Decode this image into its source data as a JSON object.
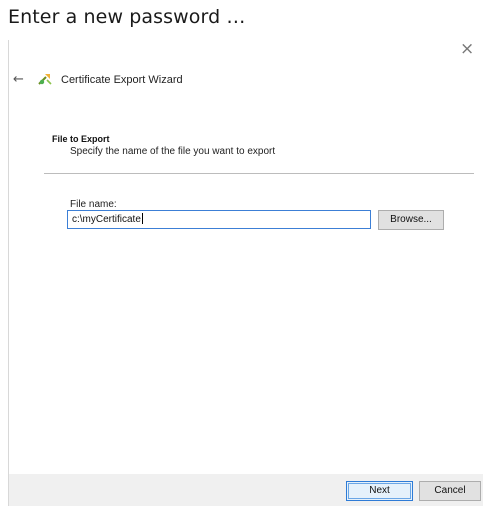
{
  "caption": "Enter a new password …",
  "window": {
    "close_glyph": "×",
    "back_glyph": "←",
    "title": "Certificate Export Wizard",
    "title_icon": "certificate-wizard-icon"
  },
  "page": {
    "section_title": "File to Export",
    "section_subtitle": "Specify the name of the file you want to export",
    "file_label": "File name:",
    "file_value": "c:\\myCertificate",
    "browse_label": "Browse..."
  },
  "footer": {
    "next_label": "Next",
    "cancel_label": "Cancel"
  },
  "colors": {
    "accent_border": "#3c7fd6",
    "footer_bg": "#f0f0f0"
  }
}
